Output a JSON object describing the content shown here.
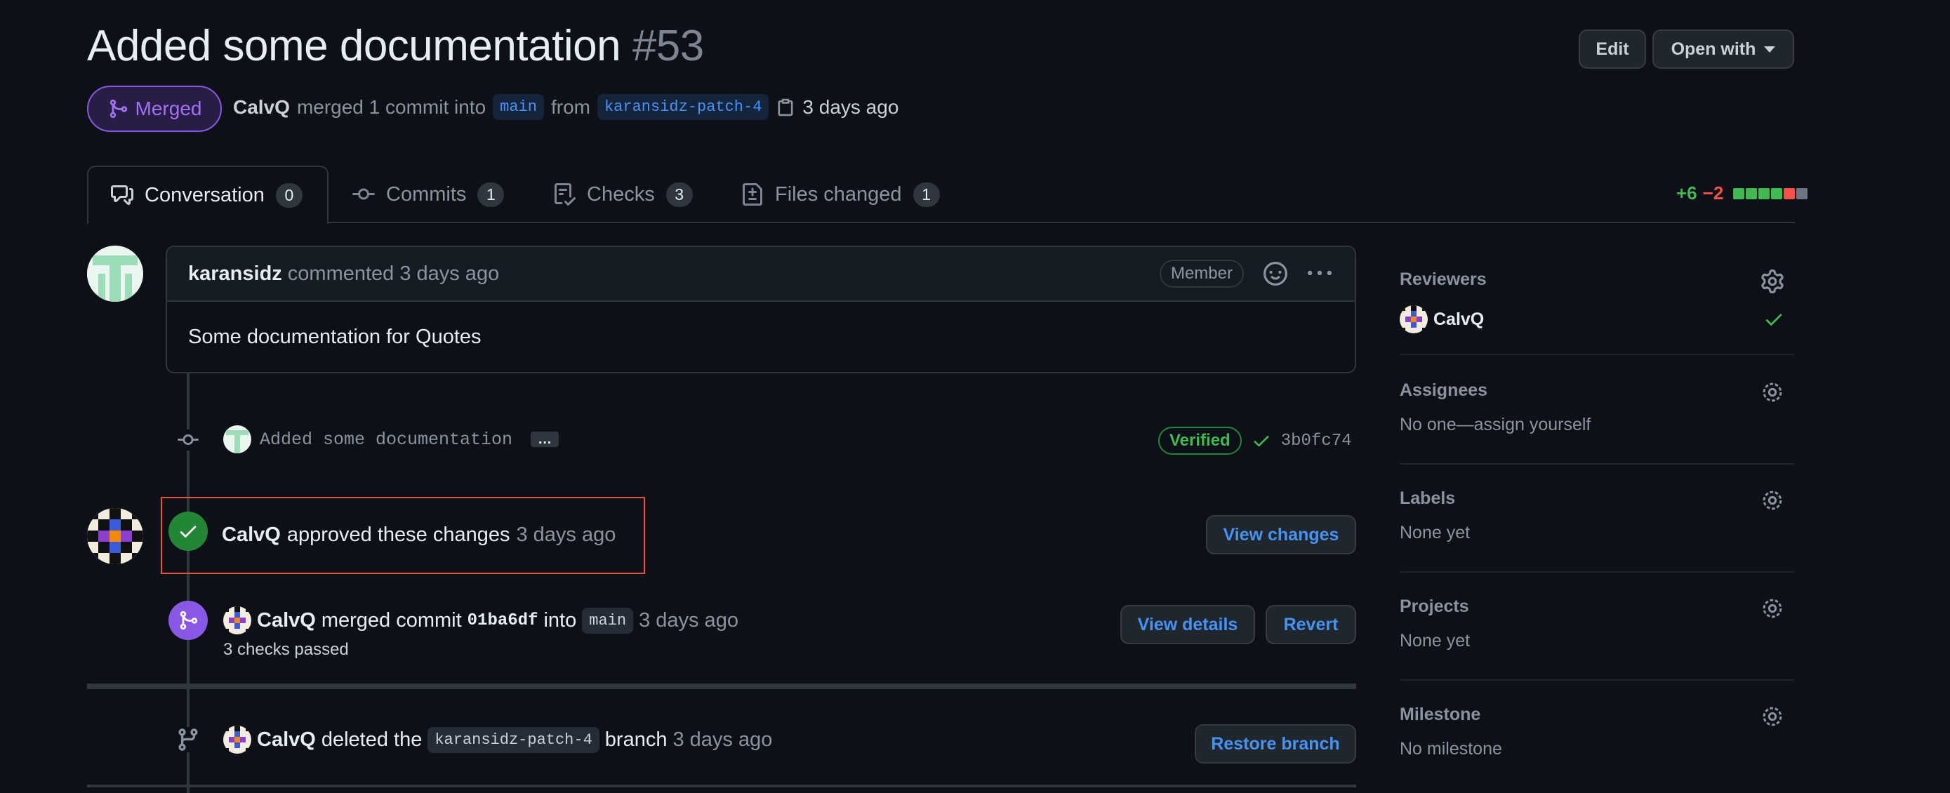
{
  "header": {
    "title": "Added some documentation",
    "number": "#53",
    "edit_label": "Edit",
    "open_with_label": "Open with",
    "state_label": "Merged",
    "author": "CalvQ",
    "merge_text": "merged 1 commit into",
    "base_branch": "main",
    "from_text": "from",
    "head_branch": "karansidz-patch-4",
    "time": "3 days ago"
  },
  "tabs": [
    {
      "label": "Conversation",
      "count": "0"
    },
    {
      "label": "Commits",
      "count": "1"
    },
    {
      "label": "Checks",
      "count": "3"
    },
    {
      "label": "Files changed",
      "count": "1"
    }
  ],
  "diffstat": {
    "additions": "+6",
    "deletions": "−2",
    "colors": [
      "#3fb950",
      "#3fb950",
      "#3fb950",
      "#3fb950",
      "#f85149",
      "#6e7681"
    ]
  },
  "comment": {
    "author": "karansidz",
    "action": "commented",
    "time": "3 days ago",
    "badge": "Member",
    "body": "Some documentation for Quotes"
  },
  "commit": {
    "message": "Added some documentation",
    "ellipsis": "…",
    "verified": "Verified",
    "sha": "3b0fc74"
  },
  "approval": {
    "author": "CalvQ",
    "text": "approved these changes",
    "time": "3 days ago",
    "button": "View changes"
  },
  "merge_event": {
    "author": "CalvQ",
    "text": "merged commit",
    "sha": "01ba6df",
    "into": "into",
    "branch": "main",
    "time": "3 days ago",
    "checks": "3 checks passed",
    "details_button": "View details",
    "revert_button": "Revert"
  },
  "delete_event": {
    "author": "CalvQ",
    "text": "deleted the",
    "branch": "karansidz-patch-4",
    "branch_word": "branch",
    "time": "3 days ago",
    "button": "Restore branch"
  },
  "sidebar": {
    "reviewers": {
      "title": "Reviewers",
      "name": "CalvQ"
    },
    "assignees": {
      "title": "Assignees",
      "value": "No one—assign yourself"
    },
    "labels": {
      "title": "Labels",
      "value": "None yet"
    },
    "projects": {
      "title": "Projects",
      "value": "None yet"
    },
    "milestone": {
      "title": "Milestone",
      "value": "No milestone"
    }
  }
}
